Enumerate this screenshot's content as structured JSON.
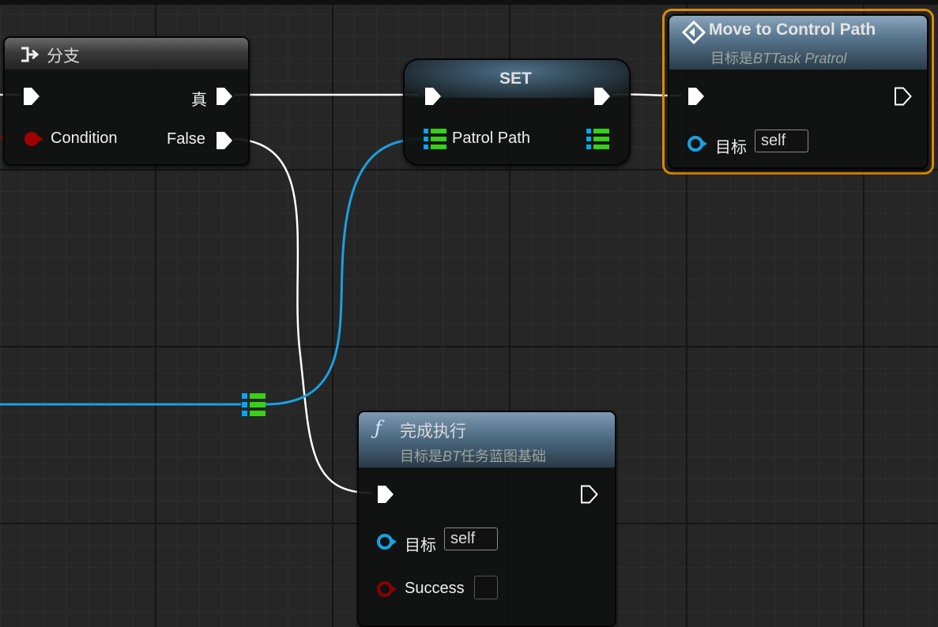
{
  "graph": {
    "branch_node": {
      "title": "分支",
      "pin_true": "真",
      "pin_condition": "Condition",
      "pin_false": "False"
    },
    "set_node": {
      "title": "SET",
      "pin_patrol_path": "Patrol Path"
    },
    "move_node": {
      "title": "Move to Control Path",
      "subtitle_prefix": "目标是",
      "subtitle_class": "BTTask Pratrol",
      "pin_target": "目标",
      "target_value": "self",
      "selected": true
    },
    "finish_node": {
      "title": "完成执行",
      "subtitle_prefix": "目标是",
      "subtitle_class": "BT",
      "subtitle_suffix": "任务蓝图基础",
      "pin_target": "目标",
      "target_value": "self",
      "pin_success": "Success",
      "success_checked": false
    },
    "reroute_node": {
      "type": "array"
    }
  },
  "colors": {
    "exec_wire": "#ffffff",
    "object_wire": "#1aa0e0",
    "array_pin_blue": "#00a8ff",
    "array_pin_green": "#38d018",
    "bool_pin": "#a00000",
    "selection_outline": "#e08a00",
    "set_header": "#3b5f7a",
    "function_header": "#49708f"
  },
  "icons": {
    "branch": "branch-icon",
    "function": "function-icon",
    "task": "diamond-icon"
  }
}
